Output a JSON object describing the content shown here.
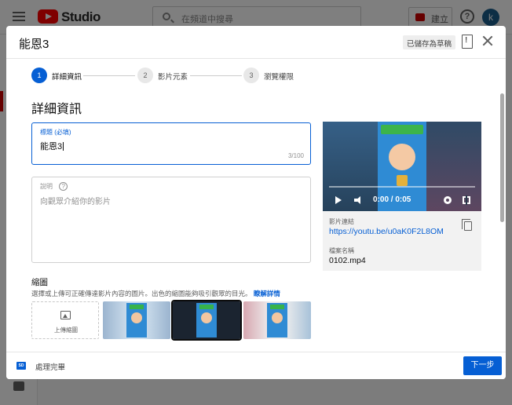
{
  "app": {
    "studio": "Studio",
    "search_placeholder": "在頻道中搜尋",
    "create_label": "建立",
    "help": "?",
    "avatar_initial": "k"
  },
  "dialog": {
    "title": "能恩3",
    "saved_chip": "已儲存為草稿",
    "steps": [
      {
        "num": "1",
        "label": "詳細資訊"
      },
      {
        "num": "2",
        "label": "影片元素"
      },
      {
        "num": "3",
        "label": "瀏覽權限"
      }
    ],
    "section_title": "詳細資訊",
    "title_field": {
      "label": "標題 (必填)",
      "value": "能恩3",
      "count": "3/100"
    },
    "description_field": {
      "label": "說明",
      "help_glyph": "?",
      "placeholder": "向觀眾介紹你的影片"
    },
    "thumbnail": {
      "title": "縮圖",
      "description": "選擇或上傳可正確傳達影片內容的圖片。出色的縮圖能夠吸引觀眾的目光。",
      "learn_more": "瞭解詳情",
      "upload_label": "上傳縮圖"
    },
    "video": {
      "time": "0:00 / 0:05",
      "link_label": "影片連結",
      "link": "https://youtu.be/u0aK0F2L8OM",
      "filename_label": "檔案名稱",
      "filename": "0102.mp4"
    },
    "footer": {
      "sd_badge": "SD",
      "status": "處理完畢",
      "next_label": "下一步"
    }
  },
  "colors": {
    "accent": "#065fd4",
    "brand_red": "#ff0000"
  }
}
